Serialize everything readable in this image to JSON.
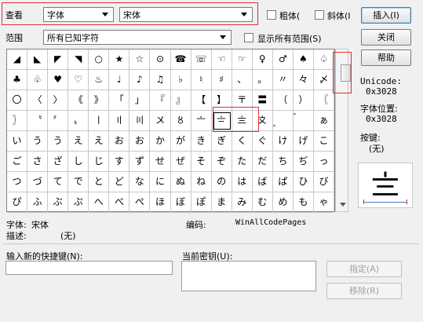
{
  "filter": {
    "view_label": "查看",
    "view_value": "字体",
    "font_value": "宋体",
    "bold_label": "粗体(",
    "italic_label": "斜体(I",
    "insert_label": "插入(I)"
  },
  "range": {
    "label": "范围",
    "value": "所有已知字符",
    "show_all_label": "显示所有范围(S)",
    "close_label": "关闭",
    "help_label": "帮助"
  },
  "grid": {
    "cells": [
      "◢",
      "◣",
      "◤",
      "◥",
      "○",
      "★",
      "☆",
      "⊙",
      "☎",
      "☏",
      "☜",
      "☞",
      "♀",
      "♂",
      "♠",
      "♤",
      "♣",
      "♧",
      "♥",
      "♡",
      "♨",
      "♩",
      "♪",
      "♫",
      "♭",
      "♮",
      "♯",
      "、",
      "。",
      "〃",
      "々",
      "〆",
      "〇",
      "〈",
      "〉",
      "《",
      "》",
      "「",
      "」",
      "『",
      "』",
      "【",
      "】",
      "〒",
      "〓",
      "（",
      "）",
      "〖",
      "〗",
      "〝",
      "〞",
      "〟",
      "〡",
      "〢",
      "〣",
      "〤",
      "〥",
      "〦",
      "〧",
      "〨",
      "〩",
      "〪",
      "〫",
      "ぁ",
      "い",
      "う",
      "う",
      "え",
      "え",
      "お",
      "お",
      "か",
      "が",
      "き",
      "ぎ",
      "く",
      "ぐ",
      "け",
      "げ",
      "こ",
      "ご",
      "さ",
      "ざ",
      "し",
      "じ",
      "す",
      "ず",
      "せ",
      "ぜ",
      "そ",
      "ぞ",
      "た",
      "だ",
      "ち",
      "ぢ",
      "っ",
      "つ",
      "づ",
      "て",
      "で",
      "と",
      "ど",
      "な",
      "に",
      "ぬ",
      "ね",
      "の",
      "は",
      "ば",
      "ぱ",
      "ひ",
      "び",
      "ぴ",
      "ふ",
      "ぶ",
      "ぷ",
      "へ",
      "べ",
      "ぺ",
      "ほ",
      "ぼ",
      "ぽ",
      "ま",
      "み",
      "む",
      "め",
      "も",
      "ゃ"
    ],
    "selected_index": 58
  },
  "info": {
    "unicode_label": "Unicode:",
    "unicode_value": "0x3028",
    "position_label": "字体位置:",
    "position_value": "0x3028",
    "key_label": "按键:",
    "key_value": "(无)",
    "preview_glyph": "〨"
  },
  "details": {
    "font_label": "字体:",
    "font_value": "宋体",
    "encoding_label": "编码:",
    "encoding_value": "WinAllCodePages",
    "desc_label": "描述:",
    "desc_value": "(无)"
  },
  "shortcut": {
    "new_label": "输入新的快捷键(N):",
    "new_value": "",
    "current_label": "当前密钥(U):",
    "assign_label": "指定(A)",
    "remove_label": "移除(R)"
  },
  "colors": {
    "highlight": "#e03030",
    "link": "#3c7fb1"
  }
}
